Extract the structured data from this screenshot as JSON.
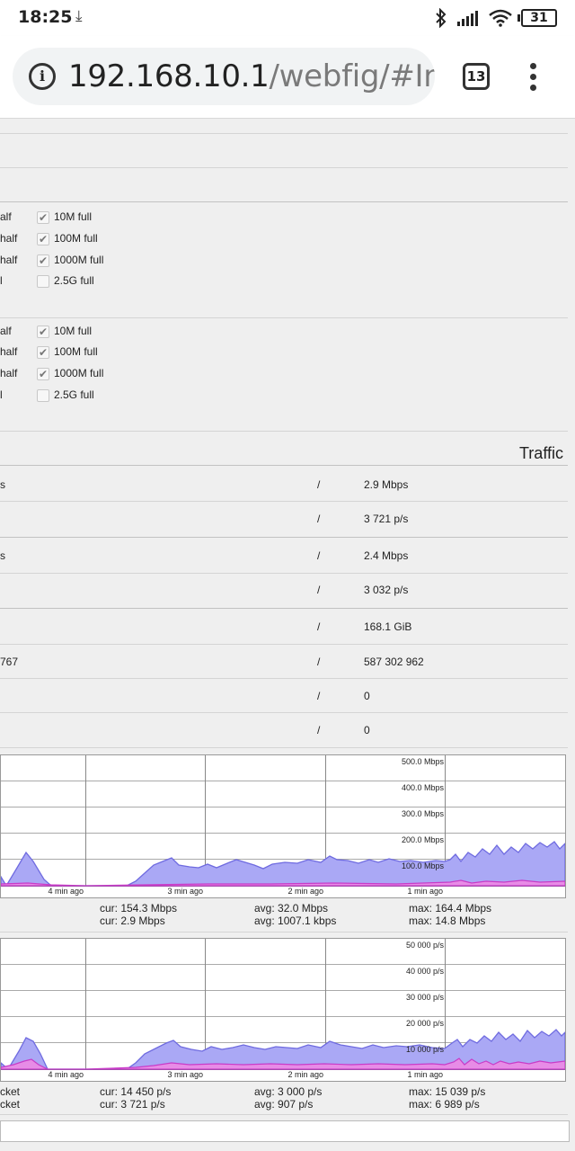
{
  "status_bar": {
    "time": "18:25",
    "battery": "31",
    "download_icon": "download-arrow-icon",
    "icons": [
      "bluetooth-icon",
      "signal-icon",
      "wifi-icon",
      "battery-icon"
    ]
  },
  "browser": {
    "url_host": "192.168.10.1",
    "url_path": "/webfig/#Int",
    "tab_count": "13"
  },
  "speeds_group1": [
    {
      "left": "alf",
      "right": "10M full",
      "checked": true
    },
    {
      "left": "half",
      "right": "100M full",
      "checked": true
    },
    {
      "left": "half",
      "right": "1000M full",
      "checked": true
    },
    {
      "left": "l",
      "right": "2.5G full",
      "checked": false
    }
  ],
  "speeds_group2": [
    {
      "left": "alf",
      "right": "10M full",
      "checked": true
    },
    {
      "left": "half",
      "right": "100M full",
      "checked": true
    },
    {
      "left": "half",
      "right": "1000M full",
      "checked": true
    },
    {
      "left": "l",
      "right": "2.5G full",
      "checked": false
    }
  ],
  "section_title": "Traffic",
  "stats": [
    {
      "left": "s",
      "sep": "/",
      "value": "2.9 Mbps"
    },
    {
      "left": "",
      "sep": "/",
      "value": "3 721 p/s"
    },
    {
      "left": "s",
      "sep": "/",
      "value": "2.4 Mbps"
    },
    {
      "left": "",
      "sep": "/",
      "value": "3 032 p/s"
    },
    {
      "left": "",
      "sep": "/",
      "value": "168.1 GiB"
    },
    {
      "left": "767",
      "sep": "/",
      "value": "587 302 962"
    },
    {
      "left": "",
      "sep": "/",
      "value": "0"
    },
    {
      "left": "",
      "sep": "/",
      "value": "0"
    }
  ],
  "graph_bits": {
    "y_labels": [
      "500.0 Mbps",
      "400.0 Mbps",
      "300.0 Mbps",
      "200.0 Mbps",
      "100.0 Mbps"
    ],
    "x_labels": [
      "4 min ago",
      "3 min ago",
      "2 min ago",
      "1 min ago"
    ],
    "cur": [
      "cur: 154.3 Mbps",
      "cur: 2.9 Mbps"
    ],
    "avg": [
      "avg: 32.0 Mbps",
      "avg: 1007.1 kbps"
    ],
    "max": [
      "max: 164.4 Mbps",
      "max: 14.8 Mbps"
    ],
    "left_labels": [
      "",
      ""
    ]
  },
  "graph_packets": {
    "y_labels": [
      "50 000 p/s",
      "40 000 p/s",
      "30 000 p/s",
      "20 000 p/s",
      "10 000 p/s"
    ],
    "x_labels": [
      "4 min ago",
      "3 min ago",
      "2 min ago",
      "1 min ago"
    ],
    "cur": [
      "cur: 14 450 p/s",
      "cur: 3 721 p/s"
    ],
    "avg": [
      "avg: 3 000 p/s",
      "avg: 907 p/s"
    ],
    "max": [
      "max: 15 039 p/s",
      "max: 6 989 p/s"
    ],
    "left_labels": [
      "cket",
      "cket"
    ]
  },
  "colors": {
    "rx_fill": "#aaa8f5",
    "rx_line": "#6f6be0",
    "tx_fill": "#e78ce6",
    "tx_line": "#c83cc8"
  }
}
